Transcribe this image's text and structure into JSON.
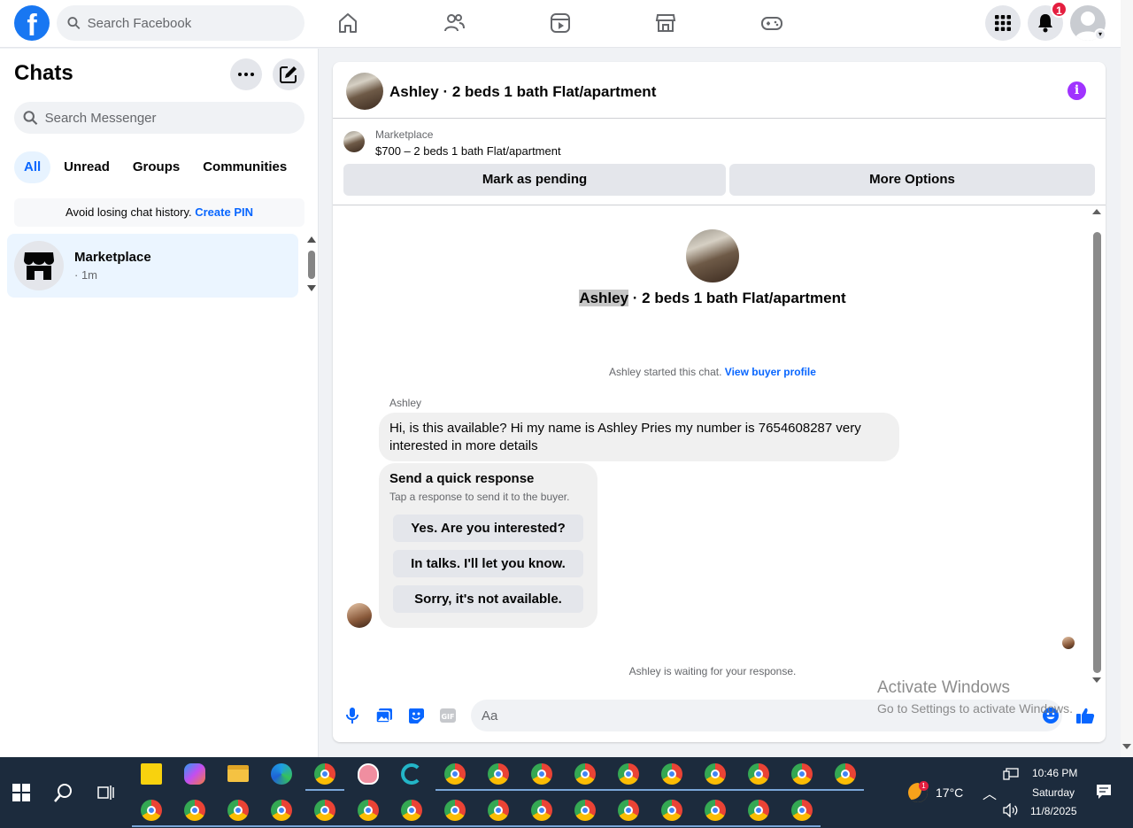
{
  "topbar": {
    "logo": "f",
    "search_placeholder": "Search Facebook",
    "notifications_count": "1",
    "nav_icons": [
      "home-icon",
      "friends-icon",
      "video-icon",
      "marketplace-icon",
      "gaming-icon"
    ]
  },
  "left": {
    "title": "Chats",
    "search_placeholder": "Search Messenger",
    "filters": [
      "All",
      "Unread",
      "Groups",
      "Communities"
    ],
    "active_filter": "All",
    "pin_banner": {
      "text": "Avoid losing chat history.",
      "link": "Create PIN"
    },
    "chats": [
      {
        "name": "Marketplace",
        "time": "· 1m"
      }
    ]
  },
  "conversation": {
    "title": "Ashley · 2 beds 1 bath Flat/apartment",
    "listing_source": "Marketplace",
    "listing": "$700 – 2 beds 1 bath Flat/apartment",
    "actions": [
      "Mark as pending",
      "More Options"
    ],
    "center_name": "Ashley",
    "center_rest": " · 2 beds 1 bath Flat/apartment",
    "started_text": "Ashley started this chat.",
    "started_link": "View buyer profile",
    "sender": "Ashley",
    "message": "Hi, is this available? Hi my name is Ashley Pries my number is 7654608287 very interested in more details",
    "quick": {
      "title": "Send a quick response",
      "subtitle": "Tap a response to send it to the buyer.",
      "options": [
        "Yes. Are you interested?",
        "In talks. I'll let you know.",
        "Sorry, it's not available."
      ]
    },
    "waiting": "Ashley is waiting for your response.",
    "composer_placeholder": "Aa"
  },
  "watermark": {
    "title": "Activate Windows",
    "subtitle": "Go to Settings to activate Windows."
  },
  "taskbar": {
    "temperature": "17°C",
    "weather_badge": "1",
    "time": "10:46 PM",
    "day": "Saturday",
    "date": "11/8/2025"
  },
  "colors": {
    "brand": "#1877f2",
    "accent": "#0866ff",
    "info": "#a033ff",
    "badge": "#e41e3f",
    "taskbar": "#1c2b3d"
  }
}
